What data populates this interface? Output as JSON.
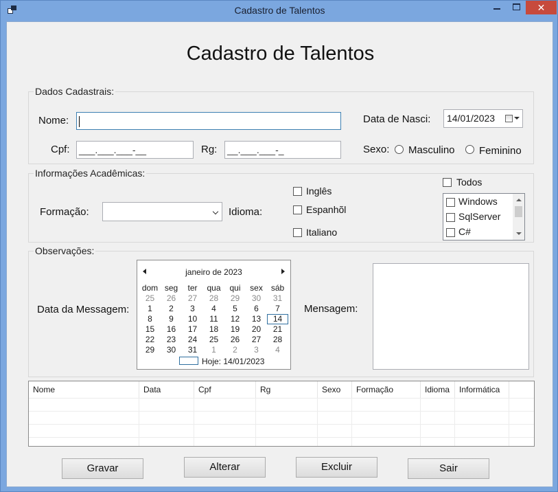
{
  "window": {
    "title": "Cadastro de Talentos",
    "close_glyph": "✕"
  },
  "form": {
    "heading": "Cadastro de Talentos"
  },
  "dados": {
    "legend": "Dados Cadastrais:",
    "nome_label": "Nome:",
    "nome_value": "",
    "cpf_label": "Cpf:",
    "cpf_value": "___.___.___-__",
    "rg_label": "Rg:",
    "rg_value": "__.___.___-_",
    "nasc_label": "Data  de Nasci:",
    "nasc_value": "14/01/2023",
    "sexo_label": "Sexo:",
    "sexo_options": [
      "Masculino",
      "Feminino"
    ]
  },
  "academicas": {
    "legend": "Informações Acadêmicas:",
    "formacao_label": "Formação:",
    "formacao_value": "",
    "idioma_label": "Idioma:",
    "idiomas": [
      "Inglês",
      "Espanhõl",
      "Italiano"
    ],
    "todos_label": "Todos",
    "informatica": [
      "Windows",
      "SqlServer",
      "C#"
    ]
  },
  "observacoes": {
    "legend": "Observações:",
    "data_msg_label": "Data da Messagem:",
    "mensagem_label": "Mensagem:",
    "mensagem_value": ""
  },
  "calendar": {
    "month_label": "janeiro de 2023",
    "weekdays": [
      "dom",
      "seg",
      "ter",
      "qua",
      "qui",
      "sex",
      "sáb"
    ],
    "weeks": [
      [
        "25",
        "26",
        "27",
        "28",
        "29",
        "30",
        "31"
      ],
      [
        "1",
        "2",
        "3",
        "4",
        "5",
        "6",
        "7"
      ],
      [
        "8",
        "9",
        "10",
        "11",
        "12",
        "13",
        "14"
      ],
      [
        "15",
        "16",
        "17",
        "18",
        "19",
        "20",
        "21"
      ],
      [
        "22",
        "23",
        "24",
        "25",
        "26",
        "27",
        "28"
      ],
      [
        "29",
        "30",
        "31",
        "1",
        "2",
        "3",
        "4"
      ]
    ],
    "selected_day": "14",
    "today_label": "Hoje: 14/01/2023"
  },
  "grid": {
    "columns": [
      "Nome",
      "Data",
      "Cpf",
      "Rg",
      "Sexo",
      "Formação",
      "Idioma",
      "Informática"
    ]
  },
  "buttons": {
    "gravar": "Gravar",
    "alterar": "Alterar",
    "excluir": "Excluir",
    "sair": "Sair"
  },
  "colors": {
    "titlebar": "#7ba7df",
    "close": "#c74a3c",
    "form_bg": "#f0f0f0"
  }
}
